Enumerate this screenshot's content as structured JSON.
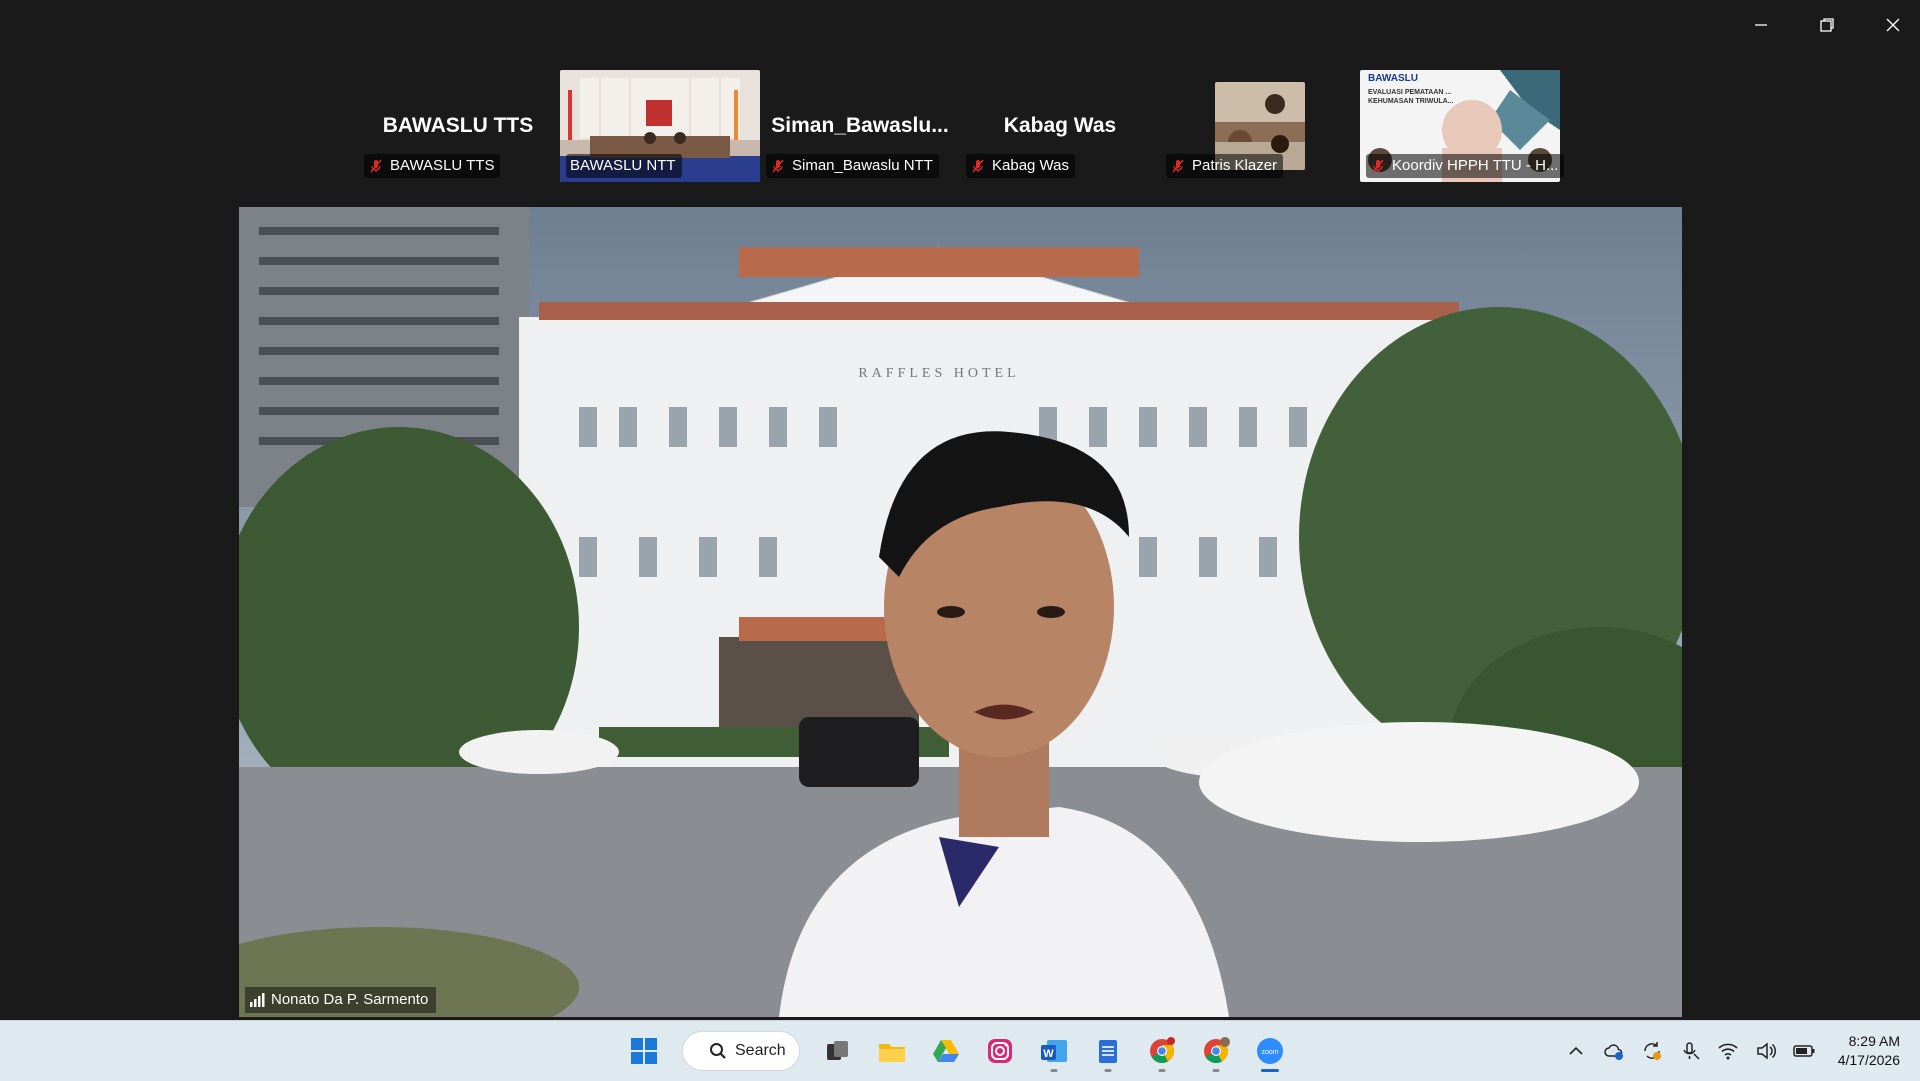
{
  "window": {
    "controls": [
      "minimize-icon",
      "restore-icon",
      "close-icon"
    ]
  },
  "participants": [
    {
      "big_name": "BAWASLU TTS",
      "label": "BAWASLU TTS",
      "has_video": false,
      "muted": true
    },
    {
      "big_name": "",
      "label": "BAWASLU NTT",
      "has_video": true,
      "muted": false
    },
    {
      "big_name": "Siman_Bawaslu...",
      "label": "Siman_Bawaslu NTT",
      "has_video": false,
      "muted": true
    },
    {
      "big_name": "Kabag Was",
      "label": "Kabag Was",
      "has_video": false,
      "muted": true
    },
    {
      "big_name": "",
      "label": "Patris Klazer",
      "has_video": true,
      "muted": true
    },
    {
      "big_name": "",
      "label": "Koordiv HPPH TTU - H...",
      "has_video": true,
      "muted": true,
      "slide_brand": "BAWASLU",
      "slide_title": "EVALUASI PEMATAAN ... KEHUMASAN TRIWULA..."
    }
  ],
  "main_speaker": {
    "name": "Nonato Da P. Sarmento",
    "backdrop_sign": "RAFFLES HOTEL"
  },
  "taskbar": {
    "search_label": "Search",
    "apps": [
      "windows-start-icon",
      "search",
      "task-view-icon",
      "file-explorer-icon",
      "google-drive-icon",
      "instagram-icon",
      "word-icon",
      "notepad-icon",
      "chrome-icon",
      "chrome-profile-icon",
      "zoom-icon"
    ],
    "tray": [
      "chevron-up-icon",
      "cloud-icon",
      "sync-icon",
      "microphone-icon",
      "wifi-icon",
      "volume-icon",
      "battery-icon"
    ],
    "time": "8:29 AM",
    "date": "4/17/2026"
  },
  "colors": {
    "background": "#1a1a1a",
    "taskbar": "#dfeaf0",
    "accent": "#1a64c8",
    "mic_off": "#e02828"
  }
}
